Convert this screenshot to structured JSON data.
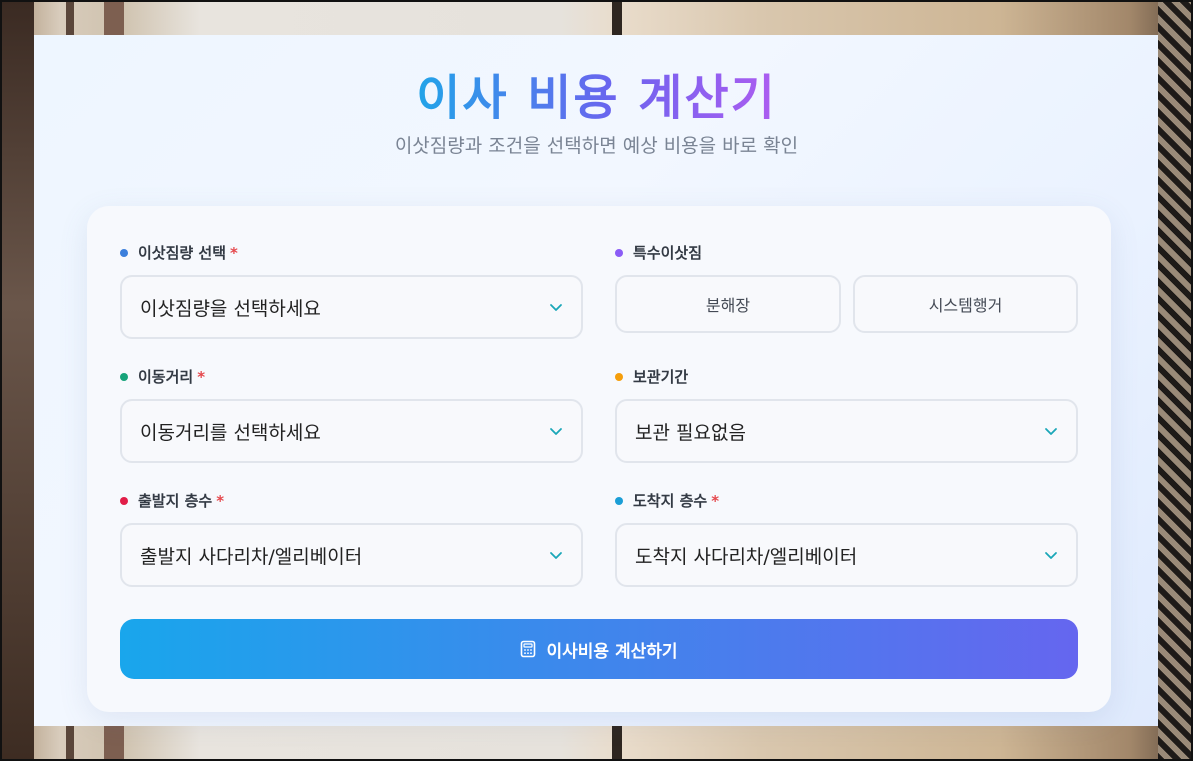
{
  "header": {
    "title": "이사 비용 계산기",
    "subtitle": "이삿짐량과 조건을 선택하면 예상 비용을 바로 확인"
  },
  "fields": {
    "volume": {
      "label": "이삿짐량 선택",
      "required": "*",
      "value": "이삿짐량을 선택하세요",
      "dot_color": "#3b7fdc"
    },
    "special": {
      "label": "특수이삿짐",
      "options": [
        "분해장",
        "시스템행거"
      ],
      "dot_color": "#8b5cf6"
    },
    "distance": {
      "label": "이동거리",
      "required": "*",
      "value": "이동거리를 선택하세요",
      "dot_color": "#16a37a"
    },
    "storage": {
      "label": "보관기간",
      "value": "보관 필요없음",
      "dot_color": "#f59e0b"
    },
    "origin_floor": {
      "label": "출발지 층수",
      "required": "*",
      "value": "출발지 사다리차/엘리베이터",
      "dot_color": "#e11d48"
    },
    "dest_floor": {
      "label": "도착지 층수",
      "required": "*",
      "value": "도착지 사다리차/엘리베이터",
      "dot_color": "#1b9ed6"
    }
  },
  "button": {
    "label": "이사비용 계산하기",
    "icon": "calculator-icon"
  },
  "colors": {
    "accent_start": "#19a6ec",
    "accent_end": "#6566ef",
    "chevron": "#1aa7b8",
    "required": "#e5484d"
  }
}
